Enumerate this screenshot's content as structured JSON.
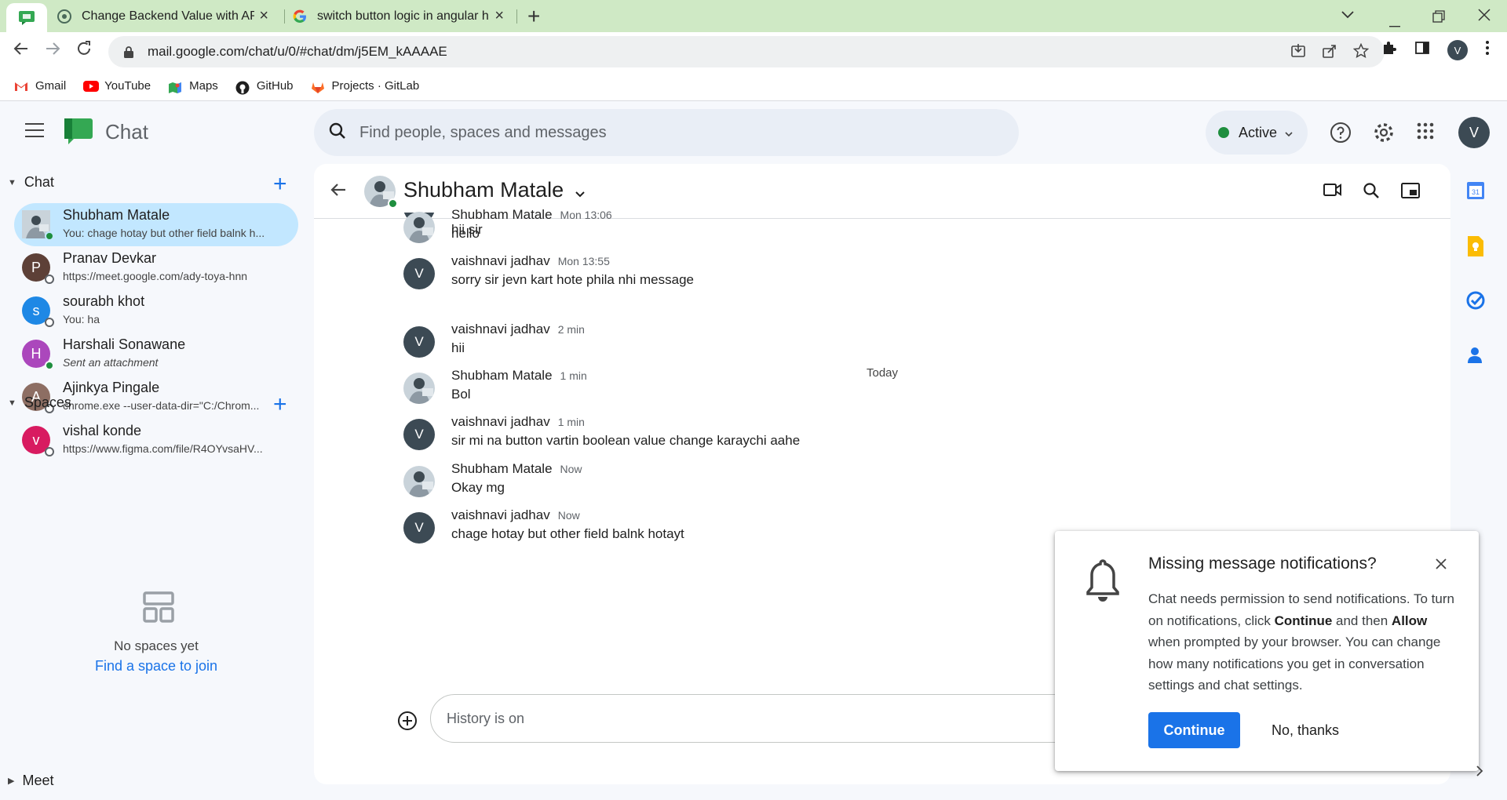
{
  "browser": {
    "tabs": [
      {
        "title": ""
      },
      {
        "title": "Change Backend Value with API"
      },
      {
        "title": "switch button logic in angular ho"
      }
    ],
    "url": "mail.google.com/chat/u/0/#chat/dm/j5EM_kAAAAE",
    "profile_initial": "V",
    "bookmarks": [
      "Gmail",
      "YouTube",
      "Maps",
      "GitHub",
      "Projects · GitLab"
    ]
  },
  "app": {
    "name": "Chat",
    "search_placeholder": "Find people, spaces and messages",
    "status": "Active",
    "user_initial": "V"
  },
  "sidebar": {
    "chat_section": "Chat",
    "spaces_section": "Spaces",
    "meet_section": "Meet",
    "dms": [
      {
        "name": "Shubham Matale",
        "snippet": "You: chage hotay but other field balnk h...",
        "initial": "",
        "color": "#7a8a94",
        "online": true
      },
      {
        "name": "Pranav Devkar",
        "snippet": "https://meet.google.com/ady-toya-hnn",
        "initial": "P",
        "color": "#5d4037",
        "online": false
      },
      {
        "name": "sourabh khot",
        "snippet": "You: ha",
        "initial": "s",
        "color": "#1e88e5",
        "online": false
      },
      {
        "name": "Harshali Sonawane",
        "snippet": "Sent an attachment",
        "initial": "H",
        "color": "#ab47bc",
        "online": true
      },
      {
        "name": "Ajinkya Pingale",
        "snippet": "chrome.exe --user-data-dir=\"C:/Chrom...",
        "initial": "A",
        "color": "#8d6e63",
        "online": false
      },
      {
        "name": "vishal konde",
        "snippet": "https://www.figma.com/file/R4OYvsaHV...",
        "initial": "v",
        "color": "#d81b60",
        "online": false
      }
    ],
    "no_spaces": "No spaces yet",
    "find_space": "Find a space to join"
  },
  "conversation": {
    "name": "Shubham Matale",
    "today_label": "Today",
    "partial_message": "hii sir",
    "messages": [
      {
        "sender": "Shubham Matale",
        "time": "Mon 13:06",
        "text": "hello",
        "initial": "",
        "photo": true
      },
      {
        "sender": "vaishnavi jadhav",
        "time": "Mon 13:55",
        "text": "sorry sir jevn kart hote phila nhi message",
        "initial": "V",
        "photo": false
      },
      {
        "sender": "vaishnavi jadhav",
        "time": "2 min",
        "text": "hii",
        "initial": "V",
        "photo": false
      },
      {
        "sender": "Shubham Matale",
        "time": "1 min",
        "text": "Bol",
        "initial": "",
        "photo": true
      },
      {
        "sender": "vaishnavi jadhav",
        "time": "1 min",
        "text": "sir mi na button vartin boolean value change karaychi aahe",
        "initial": "V",
        "photo": false
      },
      {
        "sender": "Shubham Matale",
        "time": "Now",
        "text": "Okay mg",
        "initial": "",
        "photo": true
      },
      {
        "sender": "vaishnavi jadhav",
        "time": "Now",
        "text": "chage hotay but other field balnk hotayt",
        "initial": "V",
        "photo": false
      }
    ],
    "composer_placeholder": "History is on"
  },
  "notification": {
    "title": "Missing message notifications?",
    "body_1": "Chat needs permission to send notifications. To turn on notifications, click ",
    "body_continue": "Continue",
    "body_2": " and then ",
    "body_allow": "Allow",
    "body_3": " when prompted by your browser. You can change how many notifications you get in conversation settings and chat settings.",
    "continue_label": "Continue",
    "nothanks_label": "No, thanks"
  },
  "colors": {
    "accent": "#1a73e8",
    "selected": "#c2e7ff",
    "online": "#1e8e3e",
    "tabstrip": "#cfe9c5"
  }
}
